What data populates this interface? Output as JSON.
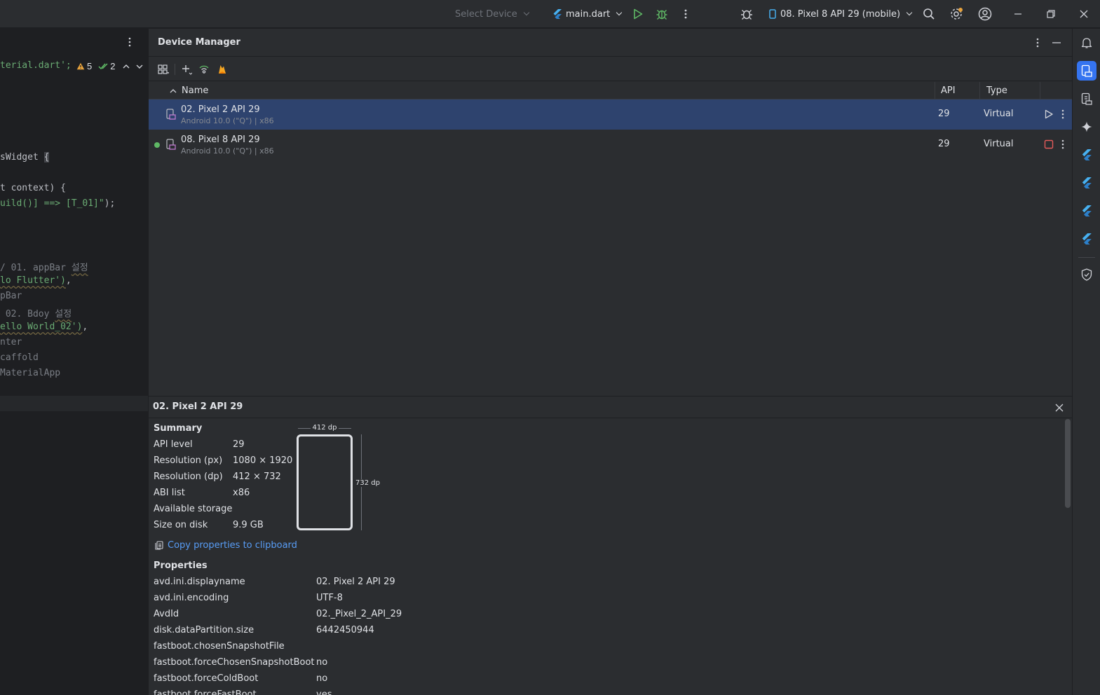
{
  "titlebar": {
    "select_device": "Select Device",
    "run_config": "main.dart",
    "running_device": "08. Pixel 8 API 29 (mobile)"
  },
  "editor": {
    "warnings": "5",
    "checks": "2",
    "lines": {
      "l1": "terial.dart';",
      "l2": "sWidget ",
      "l2b": "{",
      "l3": "t context) {",
      "l4a": "uild()] ==> [T_01]\"",
      "l4b": ");",
      "l5a": "/ 01. appBar ",
      "l5b": "설정",
      "l6a": "lo Flutter')",
      "l6b": ",",
      "l7": "pBar",
      "l8a": " 02. Bdoy ",
      "l8b": "설정",
      "l9a": "ello World_02')",
      "l9b": ",",
      "l10": "nter",
      "l11": "caffold",
      "l12": "MaterialApp"
    }
  },
  "device_manager": {
    "title": "Device Manager",
    "columns": {
      "name": "Name",
      "api": "API",
      "type": "Type"
    },
    "devices": [
      {
        "name": "02. Pixel 2 API 29",
        "sub": "Android 10.0 (\"Q\") | x86",
        "api": "29",
        "type": "Virtual",
        "running": false,
        "selected": true
      },
      {
        "name": "08. Pixel 8 API 29",
        "sub": "Android 10.0 (\"Q\") | x86",
        "api": "29",
        "type": "Virtual",
        "running": true,
        "selected": false
      }
    ]
  },
  "details": {
    "title": "02. Pixel 2 API 29",
    "summary_label": "Summary",
    "summary": [
      {
        "k": "API level",
        "v": "29"
      },
      {
        "k": "Resolution (px)",
        "v": "1080 × 1920"
      },
      {
        "k": "Resolution (dp)",
        "v": "412 × 732"
      },
      {
        "k": "ABI list",
        "v": "x86"
      },
      {
        "k": "Available storage",
        "v": ""
      },
      {
        "k": "Size on disk",
        "v": "9.9 GB"
      }
    ],
    "width_dp": "412 dp",
    "height_dp": "732 dp",
    "copy_label": "Copy properties to clipboard",
    "properties_label": "Properties",
    "properties": [
      {
        "k": "avd.ini.displayname",
        "v": "02. Pixel 2 API 29"
      },
      {
        "k": "avd.ini.encoding",
        "v": "UTF-8"
      },
      {
        "k": "AvdId",
        "v": "02._Pixel_2_API_29"
      },
      {
        "k": "disk.dataPartition.size",
        "v": "6442450944"
      },
      {
        "k": "fastboot.chosenSnapshotFile",
        "v": ""
      },
      {
        "k": "fastboot.forceChosenSnapshotBoot",
        "v": "no"
      },
      {
        "k": "fastboot.forceColdBoot",
        "v": "no"
      },
      {
        "k": "fastboot.forceFastBoot",
        "v": "yes"
      }
    ]
  },
  "colors": {
    "accent": "#3574f0",
    "selection": "#2e436e",
    "run_green": "#5fb865",
    "stop_red": "#e55b5b",
    "flutter_blue": "#47b0f0"
  }
}
